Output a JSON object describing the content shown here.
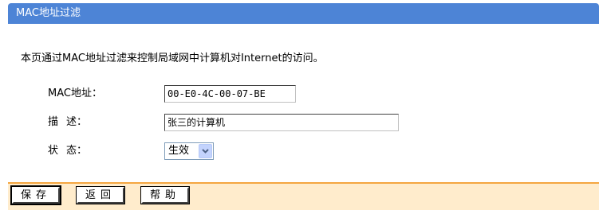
{
  "panel": {
    "title": "MAC地址过滤",
    "description": "本页通过MAC地址过滤来控制局域网中计算机对Internet的访问。"
  },
  "form": {
    "mac": {
      "label": "MAC地址：",
      "value": "00-E0-4C-00-07-BE"
    },
    "desc": {
      "label_a": "描",
      "label_b": "述：",
      "value": "张三的计算机"
    },
    "state": {
      "label_a": "状",
      "label_b": "态：",
      "selected": "生效"
    }
  },
  "buttons": {
    "save": "保存",
    "back": "返回",
    "help": "帮助"
  },
  "colors": {
    "title_bar": "#4d84d6",
    "separator": "#f4a640",
    "button_bar": "#ffeccc"
  },
  "icons": {
    "dropdown": "chevron-down-icon"
  }
}
